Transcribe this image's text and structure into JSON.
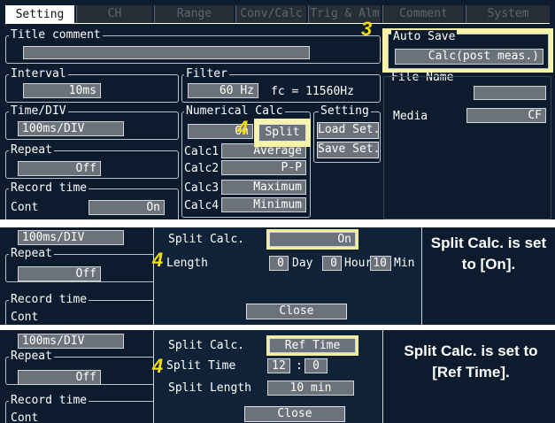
{
  "tabs": [
    "Setting",
    "CH",
    "Range",
    "Conv/Calc",
    "Trig & Alm",
    "Comment",
    "System"
  ],
  "panel1": {
    "title_comment_label": "Title comment",
    "interval_label": "Interval",
    "interval_value": "10ms",
    "filter_label": "Filter",
    "filter_value": "60 Hz",
    "fc_text": "fc = 11560Hz",
    "timediv_label": "Time/DIV",
    "timediv_value": "100ms/DIV",
    "numerical_calc_label": "Numerical Calc",
    "numerical_calc_value": "On",
    "setting_label": "Setting",
    "split_label": "Split",
    "load_set_label": "Load Set.",
    "save_set_label": "Save Set.",
    "repeat_label": "Repeat",
    "repeat_value": "Off",
    "record_time_label": "Record time",
    "record_time_mode": "Cont",
    "record_time_value": "On",
    "calcs": [
      {
        "label": "Calc1",
        "value": "Average"
      },
      {
        "label": "Calc2",
        "value": "P-P"
      },
      {
        "label": "Calc3",
        "value": "Maximum"
      },
      {
        "label": "Calc4",
        "value": "Minimum"
      }
    ],
    "auto_save_label": "Auto Save",
    "auto_save_value": "Calc(post meas.)",
    "file_name_label": "File Name",
    "media_label": "Media",
    "media_value": "CF",
    "step3": "3",
    "step4": "4"
  },
  "panel2": {
    "timediv_value": "100ms/DIV",
    "repeat_label": "Repeat",
    "repeat_value": "Off",
    "record_time_label": "Record time",
    "record_time_mode": "Cont",
    "split_calc_label": "Split Calc.",
    "split_calc_value": "On",
    "length_label": "Length",
    "day_value": "0",
    "day_unit": "Day",
    "hour_value": "0",
    "hour_unit": "Hour",
    "min_value": "10",
    "min_unit": "Min",
    "close_label": "Close",
    "step4": "4",
    "description": "Split Calc. is set to [On]."
  },
  "panel3": {
    "timediv_value": "100ms/DIV",
    "repeat_label": "Repeat",
    "repeat_value": "Off",
    "record_time_label": "Record time",
    "record_time_mode": "Cont",
    "split_calc_label": "Split Calc.",
    "split_calc_value": "Ref Time",
    "split_time_label": "Split Time",
    "split_time_hour": "12",
    "split_time_sep": ":",
    "split_time_min": "0",
    "split_length_label": "Split Length",
    "split_length_value": "10 min",
    "close_label": "Close",
    "step4": "4",
    "description": "Split Calc. is set to [Ref Time]."
  },
  "colors": {
    "background": "#0c1b2e",
    "highlight": "#f7f3a8",
    "step_number": "#f2dc12",
    "field": "#6b727a"
  }
}
